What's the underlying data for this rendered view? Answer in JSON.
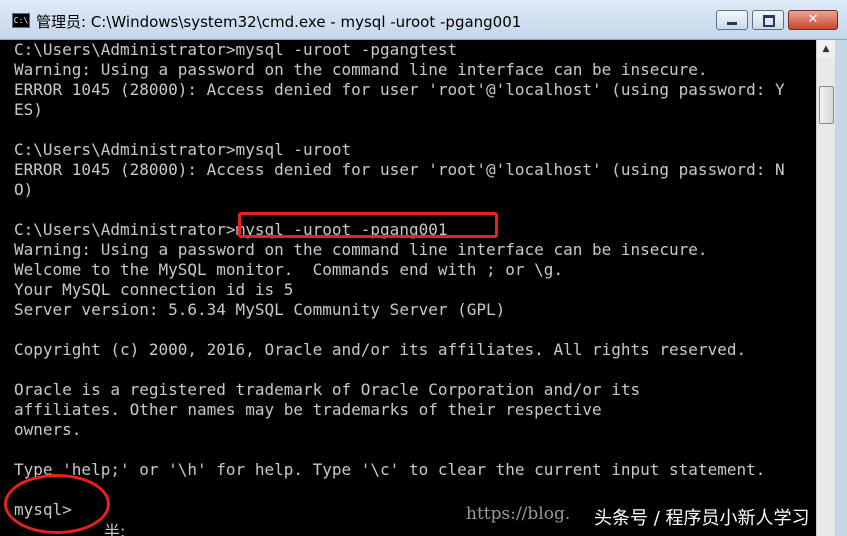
{
  "window": {
    "title": "管理员: C:\\Windows\\system32\\cmd.exe - mysql  -uroot -pgang001",
    "app_icon_label": "C:\\"
  },
  "icons": {
    "app": "console-app-icon",
    "minimize": "minimize-icon",
    "maximize": "maximize-icon",
    "close": "close-icon",
    "scroll_up": "scroll-up-arrow-icon"
  },
  "console": {
    "lines": [
      "C:\\Users\\Administrator>mysql -uroot -pgangtest",
      "Warning: Using a password on the command line interface can be insecure.",
      "ERROR 1045 (28000): Access denied for user 'root'@'localhost' (using password: Y",
      "ES)",
      "",
      "C:\\Users\\Administrator>mysql -uroot",
      "ERROR 1045 (28000): Access denied for user 'root'@'localhost' (using password: N",
      "O)",
      "",
      "C:\\Users\\Administrator>mysql -uroot -pgang001",
      "Warning: Using a password on the command line interface can be insecure.",
      "Welcome to the MySQL monitor.  Commands end with ; or \\g.",
      "Your MySQL connection id is 5",
      "Server version: 5.6.34 MySQL Community Server (GPL)",
      "",
      "Copyright (c) 2000, 2016, Oracle and/or its affiliates. All rights reserved.",
      "",
      "Oracle is a registered trademark of Oracle Corporation and/or its",
      "affiliates. Other names may be trademarks of their respective",
      "owners.",
      "",
      "Type 'help;' or '\\h' for help. Type '\\c' to clear the current input statement.",
      "",
      "mysql>"
    ],
    "residual_glyph": "半:"
  },
  "overlay": {
    "watermark_url": "https://blog.",
    "watermark_brand": "头条号 / 程序员小新人学习",
    "highlight_color": "#e8201e"
  }
}
